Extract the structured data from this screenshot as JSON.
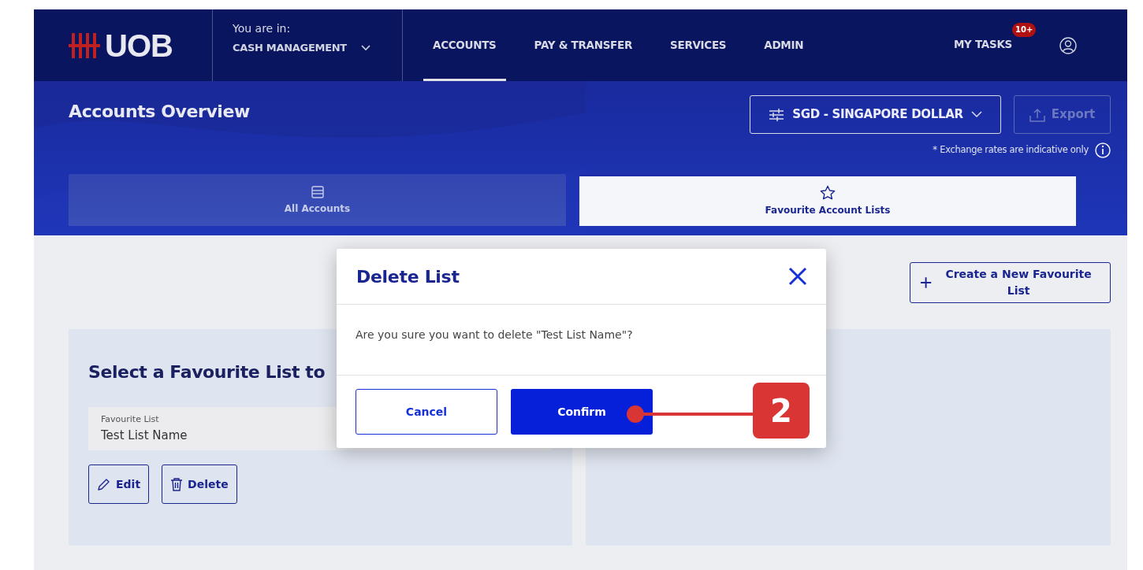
{
  "navbar": {
    "logo": "UOB",
    "context_label": "You are in:",
    "context_value": "CASH MANAGEMENT",
    "menu": [
      {
        "label": "ACCOUNTS",
        "selected": true
      },
      {
        "label": "PAY & TRANSFER",
        "selected": false
      },
      {
        "label": "SERVICES",
        "selected": false
      },
      {
        "label": "ADMIN",
        "selected": false
      }
    ],
    "tasks": {
      "label": "MY TASKS",
      "badge": "10+"
    }
  },
  "header": {
    "title": "Accounts Overview",
    "currency": "SGD - SINGAPORE DOLLAR",
    "export": {
      "label": "Export",
      "disabled": true
    },
    "note": "* Exchange rates are indicative only"
  },
  "tabs": [
    {
      "label": "All Accounts",
      "selected": false
    },
    {
      "label": "Favourite Account Lists",
      "selected": true
    }
  ],
  "create_button": "Create a New Favourite List",
  "panel": {
    "heading": "Select a Favourite List to",
    "field": {
      "label": "Favourite List",
      "value": "Test List Name"
    },
    "buttons": [
      {
        "kind": "edit",
        "label": "Edit"
      },
      {
        "kind": "delete",
        "label": "Delete"
      }
    ]
  },
  "modal": {
    "title": "Delete List",
    "message": "Are you sure you want to delete \"Test List Name\"?",
    "cancel": "Cancel",
    "confirm": "Confirm"
  },
  "annotation": {
    "step": "2"
  }
}
